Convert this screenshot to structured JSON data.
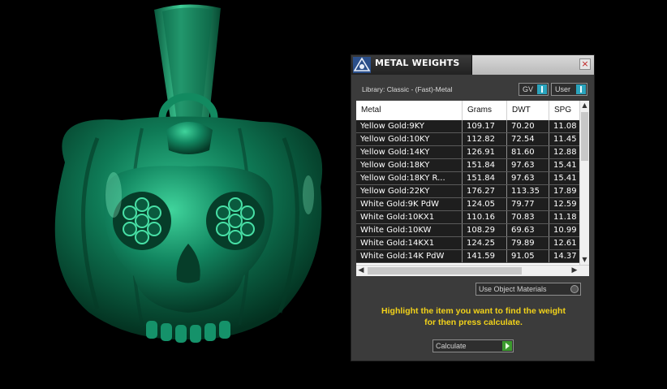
{
  "viewport": {
    "subject": "pumpkin-skull-pendant",
    "colors": {
      "background": "#000000",
      "model": "#0e6b4c"
    }
  },
  "panel": {
    "title": "METAL WEIGHTS",
    "close_label": "×",
    "library_label": "Library: Classic - (Fast)-Metal",
    "toggle_gv": "GV",
    "toggle_user": "User",
    "columns": [
      "Metal",
      "Grams",
      "DWT",
      "SPG"
    ],
    "rows": [
      [
        "Yellow Gold:9KY",
        "109.17",
        "70.20",
        "11.08"
      ],
      [
        "Yellow Gold:10KY",
        "112.82",
        "72.54",
        "11.45"
      ],
      [
        "Yellow Gold:14KY",
        "126.91",
        "81.60",
        "12.88"
      ],
      [
        "Yellow Gold:18KY",
        "151.84",
        "97.63",
        "15.41"
      ],
      [
        "Yellow Gold:18KY R...",
        "151.84",
        "97.63",
        "15.41"
      ],
      [
        "Yellow Gold:22KY",
        "176.27",
        "113.35",
        "17.89"
      ],
      [
        "White Gold:9K PdW",
        "124.05",
        "79.77",
        "12.59"
      ],
      [
        "White Gold:10KX1",
        "110.16",
        "70.83",
        "11.18"
      ],
      [
        "White Gold:10KW",
        "108.29",
        "69.63",
        "10.99"
      ],
      [
        "White Gold:14KX1",
        "124.25",
        "79.89",
        "12.61"
      ],
      [
        "White Gold:14K PdW",
        "141.59",
        "91.05",
        "14.37"
      ]
    ],
    "use_object_materials_label": "Use Object Materials",
    "instructions_line1": "Highlight the item you want to find the weight",
    "instructions_line2": "for then press calculate.",
    "calculate_label": "Calculate",
    "colors": {
      "accent": "#f2d21a",
      "toggle": "#2aa4bd",
      "go": "#3c9a2e"
    }
  }
}
